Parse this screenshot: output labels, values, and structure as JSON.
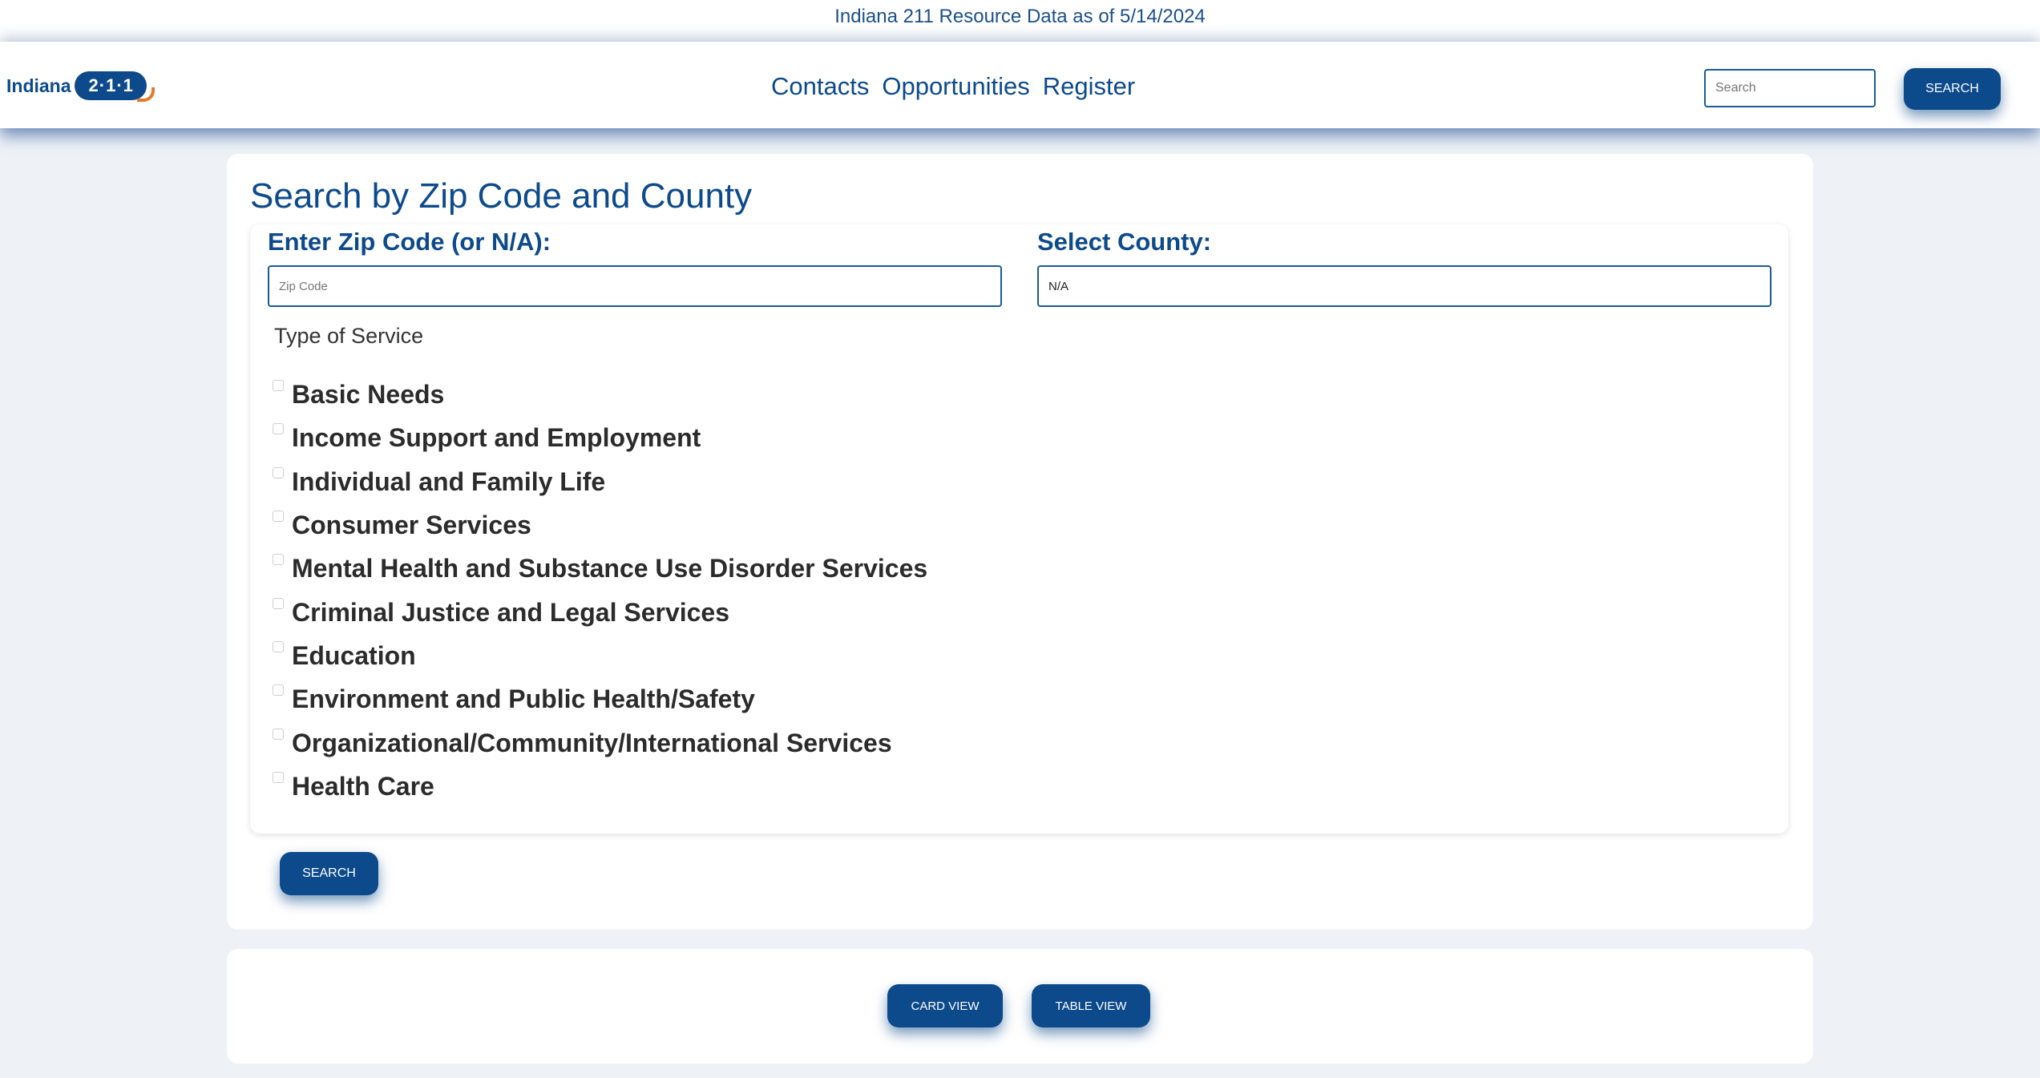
{
  "banner": {
    "text": "Indiana 211 Resource Data as of 5/14/2024"
  },
  "logo": {
    "word": "Indiana",
    "badge": "2·1·1"
  },
  "nav": {
    "links": [
      {
        "label": "Contacts"
      },
      {
        "label": "Opportunities"
      },
      {
        "label": "Register"
      }
    ],
    "search_placeholder": "Search",
    "search_button": "SEARCH"
  },
  "page": {
    "title": "Search by Zip Code and County"
  },
  "form": {
    "zip_label": "Enter Zip Code (or N/A):",
    "zip_placeholder": "Zip Code",
    "county_label": "Select County:",
    "county_value": "N/A",
    "service_type_label": "Type of Service",
    "services": [
      {
        "label": "Basic Needs",
        "checked": false
      },
      {
        "label": "Income Support and Employment",
        "checked": false
      },
      {
        "label": "Individual and Family Life",
        "checked": false
      },
      {
        "label": "Consumer Services",
        "checked": false
      },
      {
        "label": "Mental Health and Substance Use Disorder Services",
        "checked": false
      },
      {
        "label": "Criminal Justice and Legal Services",
        "checked": false
      },
      {
        "label": "Education",
        "checked": false
      },
      {
        "label": "Environment and Public Health/Safety",
        "checked": false
      },
      {
        "label": "Organizational/Community/International Services",
        "checked": false
      },
      {
        "label": "Health Care",
        "checked": false
      }
    ],
    "search_button": "SEARCH"
  },
  "views": {
    "card_view": "CARD VIEW",
    "table_view": "TABLE VIEW"
  },
  "colors": {
    "brand": "#0c4a8b",
    "accent": "#e8782a",
    "background": "#eef2f6"
  }
}
